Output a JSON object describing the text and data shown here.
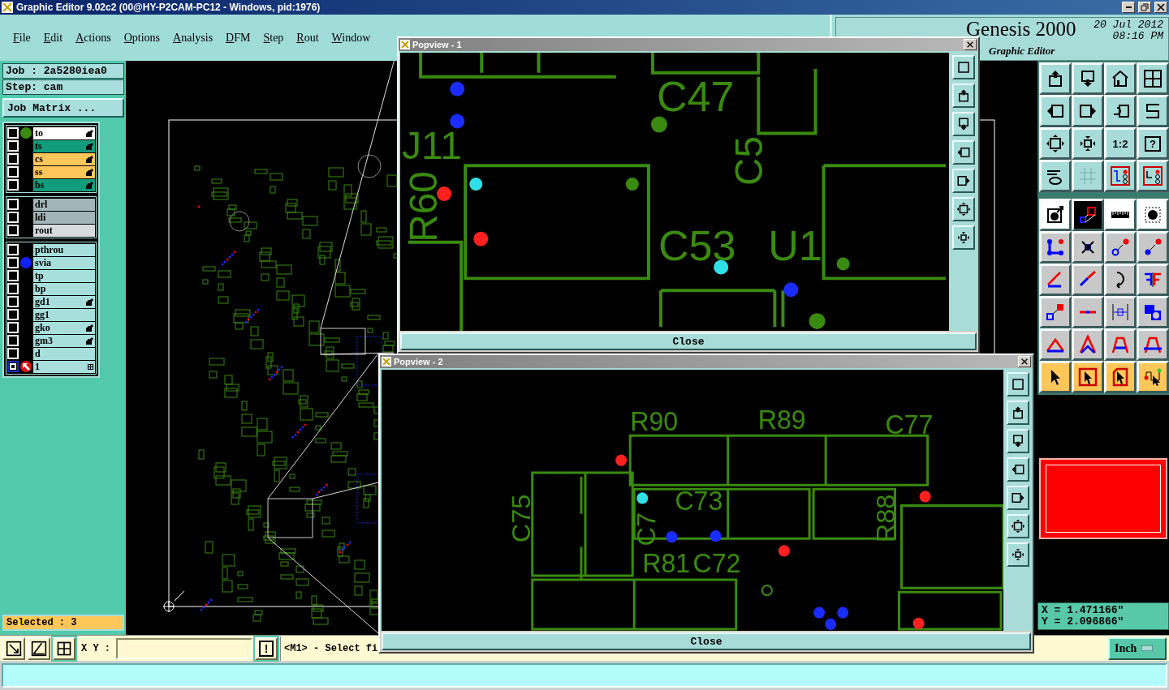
{
  "window": {
    "title": "Graphic Editor 9.02c2 (00@HY-P2CAM-PC12 - Windows, pid:1976)"
  },
  "menu": [
    "File",
    "Edit",
    "Actions",
    "Options",
    "Analysis",
    "DFM",
    "Step",
    "Rout",
    "Window"
  ],
  "brand": {
    "product": "Genesis 2000",
    "subtitle": "Graphic Editor",
    "date": "20 Jul 2012",
    "time": "08:16 PM"
  },
  "job": {
    "job": "Job : 2a5280iea0",
    "step": "Step: cam",
    "matrix_button": "Job Matrix ..."
  },
  "layer_groups": [
    [
      {
        "name": "to",
        "color": "#ffffff",
        "kind": "dot",
        "dot": {
          "color": "#3a8a10"
        },
        "affected": true,
        "current": false
      },
      {
        "name": "ts",
        "color": "#119c7c",
        "kind": "plain",
        "affected": true,
        "current": false
      },
      {
        "name": "cs",
        "color": "#ffc65a",
        "kind": "plain",
        "affected": true,
        "current": false
      },
      {
        "name": "ss",
        "color": "#ffc65a",
        "kind": "plain",
        "affected": true,
        "current": false
      },
      {
        "name": "bs",
        "color": "#119c7c",
        "kind": "plain",
        "affected": true,
        "current": false
      }
    ],
    [
      {
        "name": "drl",
        "color": "#a2b6ba",
        "kind": "plain",
        "affected": false,
        "current": false
      },
      {
        "name": "ldi",
        "color": "#a2b6ba",
        "kind": "plain",
        "affected": false,
        "current": false
      },
      {
        "name": "rout",
        "color": "#d8dcdc",
        "kind": "plain",
        "affected": false,
        "current": false
      }
    ],
    [
      {
        "name": "pthrou",
        "color": "#a8dedb",
        "kind": "plain",
        "affected": false,
        "current": false
      },
      {
        "name": "svia",
        "color": "#a8dedb",
        "kind": "dot",
        "dot": {
          "color": "#1020ff"
        },
        "affected": false,
        "current": false
      },
      {
        "name": "tp",
        "color": "#a8dedb",
        "kind": "plain",
        "affected": false,
        "current": false
      },
      {
        "name": "bp",
        "color": "#a8dedb",
        "kind": "plain",
        "affected": false,
        "current": false
      },
      {
        "name": "gd1",
        "color": "#a8dedb",
        "kind": "plain",
        "affected": true,
        "current": false
      },
      {
        "name": "gg1",
        "color": "#a8dedb",
        "kind": "plain",
        "affected": false,
        "current": false
      },
      {
        "name": "gko",
        "color": "#a8dedb",
        "kind": "plain",
        "affected": true,
        "current": false
      },
      {
        "name": "gm3",
        "color": "#a8dedb",
        "kind": "plain",
        "affected": true,
        "current": false
      },
      {
        "name": "d",
        "color": "#a8dedb",
        "kind": "plain",
        "affected": false,
        "current": false
      },
      {
        "name": "1",
        "color": "#a8dedb",
        "kind": "work",
        "dot": {
          "color": "#e01010"
        },
        "affected": false,
        "current": true
      }
    ]
  ],
  "selected_count": "Selected : 3",
  "toolbar": {
    "scale_key": "1:2",
    "help_key": "?"
  },
  "coordinates": {
    "x": "X = 1.471166\"",
    "y": "Y = 2.096866\""
  },
  "bottom_bar": {
    "xy_label": "X Y :",
    "alert_key": "!",
    "prompt": "<M1> - Select fi",
    "units": "Inch"
  },
  "popviews": [
    {
      "title": "Popview - 1",
      "labels": [
        "C47",
        "J11",
        "R60",
        "C5",
        "C53",
        "U1"
      ],
      "close": "Close"
    },
    {
      "title": "Popview - 2",
      "labels": [
        "R90",
        "R89",
        "C77",
        "C75",
        "C73",
        "R88",
        "C7",
        "R81",
        "C72"
      ],
      "close": "Close"
    }
  ]
}
